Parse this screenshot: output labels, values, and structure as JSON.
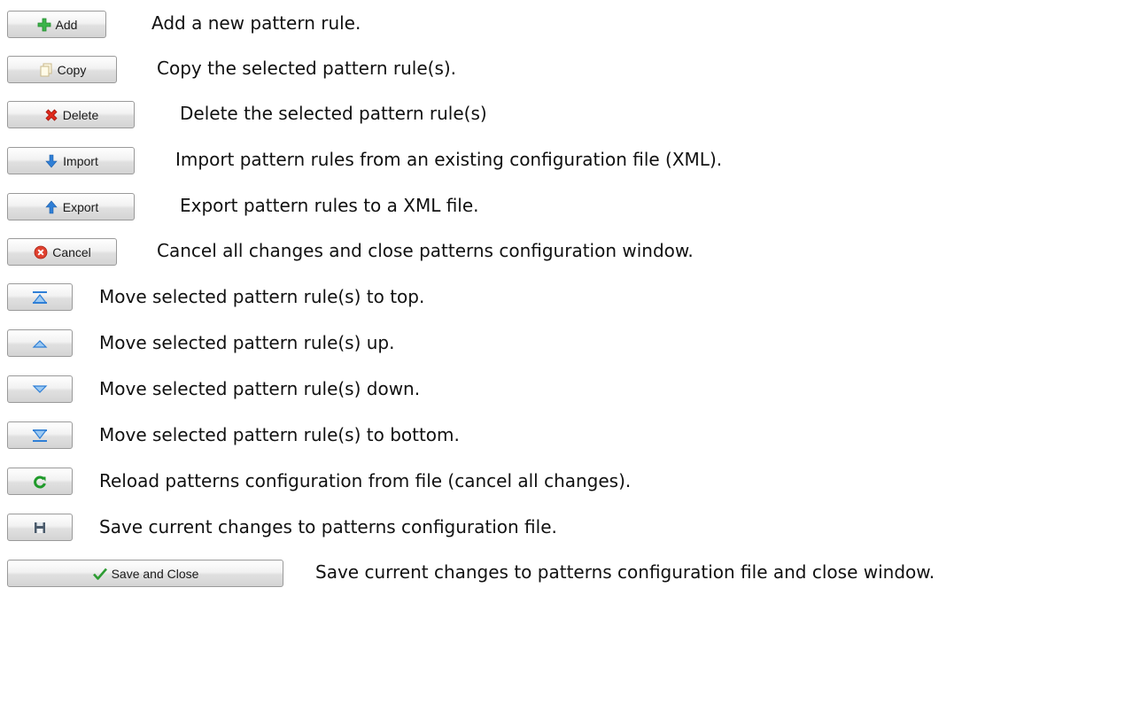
{
  "items": [
    {
      "label": "Add",
      "icon": "plus-icon",
      "description": "Add a new pattern rule."
    },
    {
      "label": "Copy",
      "icon": "copy-document-icon",
      "description": "Copy the selected pattern rule(s)."
    },
    {
      "label": "Delete",
      "icon": "red-x-icon",
      "description": "Delete the selected pattern rule(s)"
    },
    {
      "label": "Import",
      "icon": "arrow-down-icon",
      "description": "Import pattern rules from an existing configuration file (XML)."
    },
    {
      "label": "Export",
      "icon": "arrow-up-icon",
      "description": "Export pattern rules to a XML file."
    },
    {
      "label": "Cancel",
      "icon": "cancel-circle-icon",
      "description": "Cancel all changes and close patterns configuration window."
    },
    {
      "label": "",
      "icon": "move-top-icon",
      "description": "Move selected pattern rule(s) to top."
    },
    {
      "label": "",
      "icon": "move-up-icon",
      "description": "Move selected pattern rule(s) up."
    },
    {
      "label": "",
      "icon": "move-down-icon",
      "description": "Move selected pattern rule(s) down."
    },
    {
      "label": "",
      "icon": "move-bottom-icon",
      "description": "Move selected pattern rule(s) to bottom."
    },
    {
      "label": "",
      "icon": "reload-icon",
      "description": "Reload patterns configuration from file (cancel all changes)."
    },
    {
      "label": "",
      "icon": "save-disk-icon",
      "description": "Save current changes to patterns configuration file."
    },
    {
      "label": "Save and Close",
      "icon": "checkmark-icon",
      "description": "Save current changes to patterns configuration file and close window."
    }
  ]
}
